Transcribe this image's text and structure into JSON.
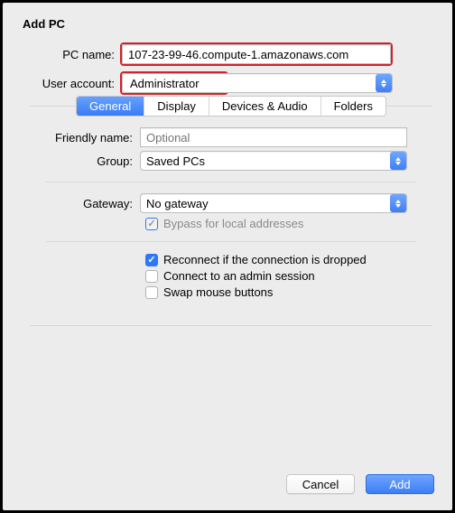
{
  "title": "Add PC",
  "top": {
    "pc_name_label": "PC name:",
    "pc_name_value": "107-23-99-46.compute-1.amazonaws.com",
    "user_account_label": "User account:",
    "user_account_value": "Administrator"
  },
  "tabs": {
    "general": "General",
    "display": "Display",
    "devices": "Devices & Audio",
    "folders": "Folders"
  },
  "general": {
    "friendly_label": "Friendly name:",
    "friendly_placeholder": "Optional",
    "group_label": "Group:",
    "group_value": "Saved PCs",
    "gateway_label": "Gateway:",
    "gateway_value": "No gateway",
    "bypass_label": "Bypass for local addresses",
    "reconnect_label": "Reconnect if the connection is dropped",
    "admin_label": "Connect to an admin session",
    "swap_label": "Swap mouse buttons"
  },
  "footer": {
    "cancel": "Cancel",
    "add": "Add"
  }
}
